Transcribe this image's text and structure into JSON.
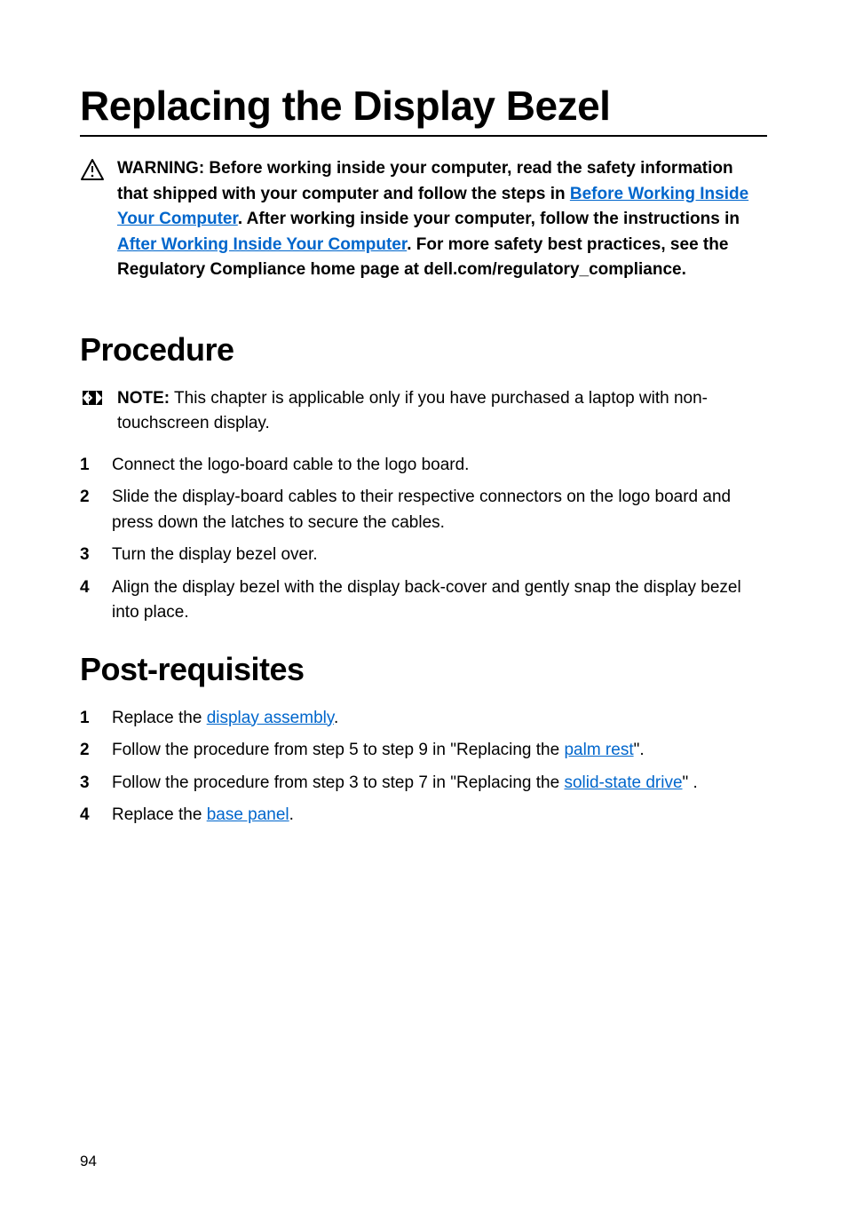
{
  "title": "Replacing the Display Bezel",
  "warning": {
    "prefix": "WARNING: Before working inside your computer, read the safety information that shipped with your computer and follow the steps in ",
    "link1": "Before Working Inside Your Computer",
    "middle1": ". After working inside your computer, follow the instructions in ",
    "link2": "After Working Inside Your Computer",
    "suffix": ". For more safety best practices, see the Regulatory Compliance home page at dell.com/regulatory_compliance."
  },
  "procedure": {
    "heading": "Procedure",
    "note": {
      "label": "NOTE:",
      "text": " This chapter is applicable only if you have purchased a laptop with non-touchscreen display."
    },
    "steps": [
      "Connect the logo-board cable to the logo board.",
      "Slide the display-board cables to their respective connectors on the logo board and press down the latches to secure the cables.",
      "Turn the display bezel over.",
      "Align the display bezel with the display back-cover and gently snap the display bezel into place."
    ]
  },
  "postreq": {
    "heading": "Post-requisites",
    "steps": [
      {
        "prefix": "Replace the ",
        "link": "display assembly",
        "suffix": "."
      },
      {
        "prefix": "Follow the procedure from step 5 to step 9 in \"Replacing the ",
        "link": "palm rest",
        "suffix": "\"."
      },
      {
        "prefix": "Follow the procedure from step 3 to step 7 in \"Replacing the ",
        "link": "solid-state drive",
        "suffix": "\" ."
      },
      {
        "prefix": "Replace the ",
        "link": "base panel",
        "suffix": "."
      }
    ]
  },
  "pageNumber": "94"
}
